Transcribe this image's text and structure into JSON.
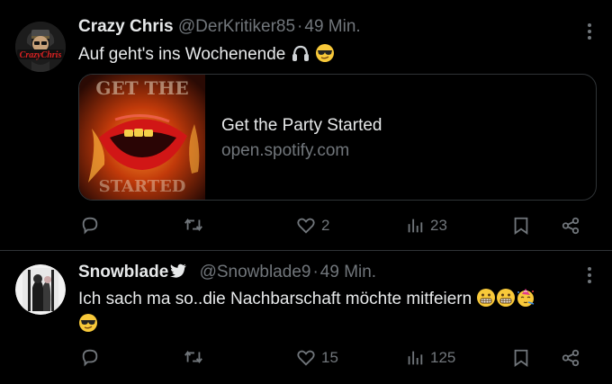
{
  "tweets": [
    {
      "author": "Crazy Chris",
      "handle": "@DerKritiker85",
      "separator": "·",
      "time": "49 Min.",
      "text": "Auf geht's ins Wochenende",
      "emojis": [
        "headphones-emoji",
        "sunglasses-face-emoji"
      ],
      "card": {
        "title": "Get the Party Started",
        "domain": "open.spotify.com",
        "thumb_text": "GET THE PARTY STARTED"
      },
      "actions": {
        "replies": "",
        "retweets": "",
        "likes": "2",
        "views": "23"
      }
    },
    {
      "author": "Snowblade",
      "handle": "@Snowblade9",
      "separator": "·",
      "time": "49 Min.",
      "text": "Ich sach ma so..die Nachbarschaft möchte mitfeiern",
      "emojis": [
        "grimacing-face-emoji",
        "grimacing-face-emoji",
        "partying-face-emoji",
        "sunglasses-face-emoji"
      ],
      "actions": {
        "replies": "",
        "retweets": "",
        "likes": "15",
        "views": "125"
      }
    }
  ],
  "colors": {
    "background": "#000000",
    "text": "#e7e9ea",
    "muted": "#71767b",
    "border": "#2f3336",
    "emoji": "#f8c93a"
  }
}
